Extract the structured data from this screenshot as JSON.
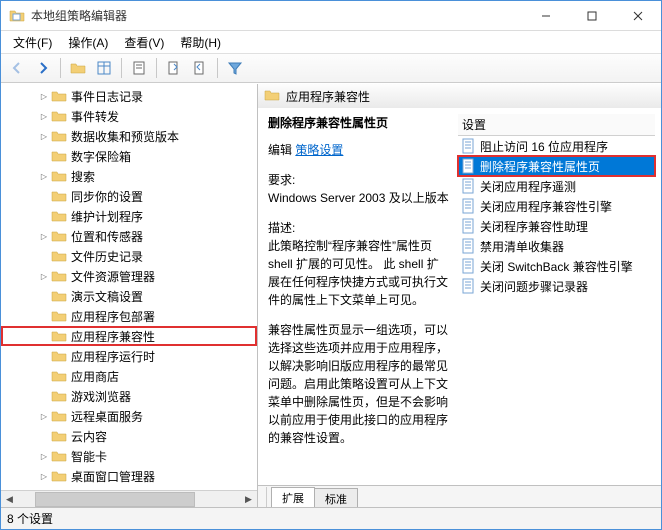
{
  "window": {
    "title": "本地组策略编辑器"
  },
  "menu": {
    "file": "文件(F)",
    "action": "操作(A)",
    "view": "查看(V)",
    "help": "帮助(H)"
  },
  "tree": {
    "items": [
      {
        "label": "事件日志记录",
        "expandable": true
      },
      {
        "label": "事件转发",
        "expandable": true
      },
      {
        "label": "数据收集和预览版本",
        "expandable": true
      },
      {
        "label": "数字保险箱",
        "expandable": false
      },
      {
        "label": "搜索",
        "expandable": true
      },
      {
        "label": "同步你的设置",
        "expandable": false
      },
      {
        "label": "维护计划程序",
        "expandable": false
      },
      {
        "label": "位置和传感器",
        "expandable": true
      },
      {
        "label": "文件历史记录",
        "expandable": false
      },
      {
        "label": "文件资源管理器",
        "expandable": true
      },
      {
        "label": "演示文稿设置",
        "expandable": false
      },
      {
        "label": "应用程序包部署",
        "expandable": false
      },
      {
        "label": "应用程序兼容性",
        "expandable": false,
        "highlighted": true
      },
      {
        "label": "应用程序运行时",
        "expandable": false
      },
      {
        "label": "应用商店",
        "expandable": false
      },
      {
        "label": "游戏浏览器",
        "expandable": false
      },
      {
        "label": "远程桌面服务",
        "expandable": true
      },
      {
        "label": "云内容",
        "expandable": false
      },
      {
        "label": "智能卡",
        "expandable": true
      },
      {
        "label": "桌面窗口管理器",
        "expandable": true
      }
    ]
  },
  "detail": {
    "header_title": "应用程序兼容性",
    "info": {
      "heading": "删除程序兼容性属性页",
      "edit_label": "编辑",
      "edit_link": "策略设置",
      "req_label": "要求:",
      "req_value": "Windows Server 2003 及以上版本",
      "desc_label": "描述:",
      "desc_body1": "此策略控制“程序兼容性”属性页 shell 扩展的可见性。 此 shell 扩展在任何程序快捷方式或可执行文件的属性上下文菜单上可见。",
      "desc_body2": "兼容性属性页显示一组选项，可以选择这些选项并应用于应用程序，以解决影响旧版应用程序的最常见问题。启用此策略设置可从上下文菜单中删除属性页，但是不会影响以前应用于使用此接口的应用程序的兼容性设置。"
    },
    "list_header": "设置",
    "list_items": [
      {
        "label": "阻止访问 16 位应用程序"
      },
      {
        "label": "删除程序兼容性属性页",
        "selected": true,
        "highlighted": true
      },
      {
        "label": "关闭应用程序遥测"
      },
      {
        "label": "关闭应用程序兼容性引擎"
      },
      {
        "label": "关闭程序兼容性助理"
      },
      {
        "label": "禁用清单收集器"
      },
      {
        "label": "关闭 SwitchBack 兼容性引擎"
      },
      {
        "label": "关闭问题步骤记录器"
      }
    ]
  },
  "tabs": {
    "extended": "扩展",
    "standard": "标准"
  },
  "status": {
    "text": "8 个设置"
  }
}
